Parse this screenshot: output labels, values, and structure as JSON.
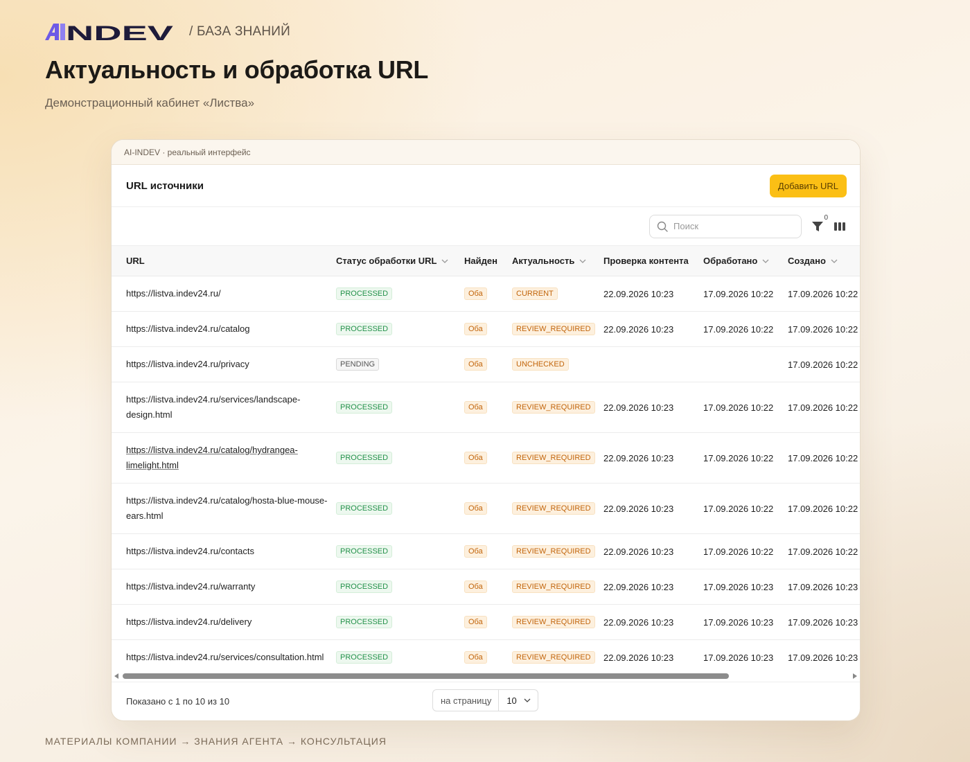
{
  "brand": {
    "logo_text": "AINDEV",
    "section": "/ БАЗА ЗНАНИЙ"
  },
  "page": {
    "title": "Актуальность и обработка URL",
    "subtitle": "Демонстрационный кабинет «Листва»"
  },
  "frame": {
    "caption": "AI-INDEV · реальный интерфейс"
  },
  "card": {
    "title": "URL источники",
    "add_button": "Добавить URL"
  },
  "toolbar": {
    "search_placeholder": "Поиск",
    "filter_count": "0"
  },
  "table": {
    "columns": {
      "url": "URL",
      "status": "Статус обработки URL",
      "found": "Найден",
      "relevance": "Актуальность",
      "content_check": "Проверка контента",
      "processed": "Обработано",
      "created": "Создано"
    },
    "rows": [
      {
        "url": "https://listva.indev24.ru/",
        "status": "PROCESSED",
        "found": "Оба",
        "relevance": "CURRENT",
        "content_check": "22.09.2026 10:23",
        "processed": "17.09.2026 10:22",
        "created": "17.09.2026 10:22"
      },
      {
        "url": "https://listva.indev24.ru/catalog",
        "status": "PROCESSED",
        "found": "Оба",
        "relevance": "REVIEW_REQUIRED",
        "content_check": "22.09.2026 10:23",
        "processed": "17.09.2026 10:22",
        "created": "17.09.2026 10:22"
      },
      {
        "url": "https://listva.indev24.ru/privacy",
        "status": "PENDING",
        "found": "Оба",
        "relevance": "UNCHECKED",
        "content_check": "",
        "processed": "",
        "created": "17.09.2026 10:22"
      },
      {
        "url": "https://listva.indev24.ru/services/landscape-design.html",
        "status": "PROCESSED",
        "found": "Оба",
        "relevance": "REVIEW_REQUIRED",
        "content_check": "22.09.2026 10:23",
        "processed": "17.09.2026 10:22",
        "created": "17.09.2026 10:22"
      },
      {
        "url": "https://listva.indev24.ru/catalog/hydrangea-limelight.html",
        "status": "PROCESSED",
        "found": "Оба",
        "relevance": "REVIEW_REQUIRED",
        "content_check": "22.09.2026 10:23",
        "processed": "17.09.2026 10:22",
        "created": "17.09.2026 10:22"
      },
      {
        "url": "https://listva.indev24.ru/catalog/hosta-blue-mouse-ears.html",
        "status": "PROCESSED",
        "found": "Оба",
        "relevance": "REVIEW_REQUIRED",
        "content_check": "22.09.2026 10:23",
        "processed": "17.09.2026 10:22",
        "created": "17.09.2026 10:22"
      },
      {
        "url": "https://listva.indev24.ru/contacts",
        "status": "PROCESSED",
        "found": "Оба",
        "relevance": "REVIEW_REQUIRED",
        "content_check": "22.09.2026 10:23",
        "processed": "17.09.2026 10:22",
        "created": "17.09.2026 10:22"
      },
      {
        "url": "https://listva.indev24.ru/warranty",
        "status": "PROCESSED",
        "found": "Оба",
        "relevance": "REVIEW_REQUIRED",
        "content_check": "22.09.2026 10:23",
        "processed": "17.09.2026 10:23",
        "created": "17.09.2026 10:23"
      },
      {
        "url": "https://listva.indev24.ru/delivery",
        "status": "PROCESSED",
        "found": "Оба",
        "relevance": "REVIEW_REQUIRED",
        "content_check": "22.09.2026 10:23",
        "processed": "17.09.2026 10:23",
        "created": "17.09.2026 10:23"
      },
      {
        "url": "https://listva.indev24.ru/services/consultation.html",
        "status": "PROCESSED",
        "found": "Оба",
        "relevance": "REVIEW_REQUIRED",
        "content_check": "22.09.2026 10:23",
        "processed": "17.09.2026 10:23",
        "created": "17.09.2026 10:23"
      }
    ]
  },
  "pagination": {
    "summary": "Показано с 1 по 10 из 10",
    "per_page_label": "на страницу",
    "per_page_value": "10"
  },
  "footer": {
    "crumbs": "МАТЕРИАЛЫ КОМПАНИИ → ЗНАНИЯ АГЕНТА → КОНСУЛЬТАЦИЯ"
  },
  "colors": {
    "accent": "#fbbf15",
    "logo_purple": "#6d5ae6",
    "logo_dark": "#1e1b3a",
    "processed_green": "#23914a",
    "warning_orange": "#c2650b"
  }
}
